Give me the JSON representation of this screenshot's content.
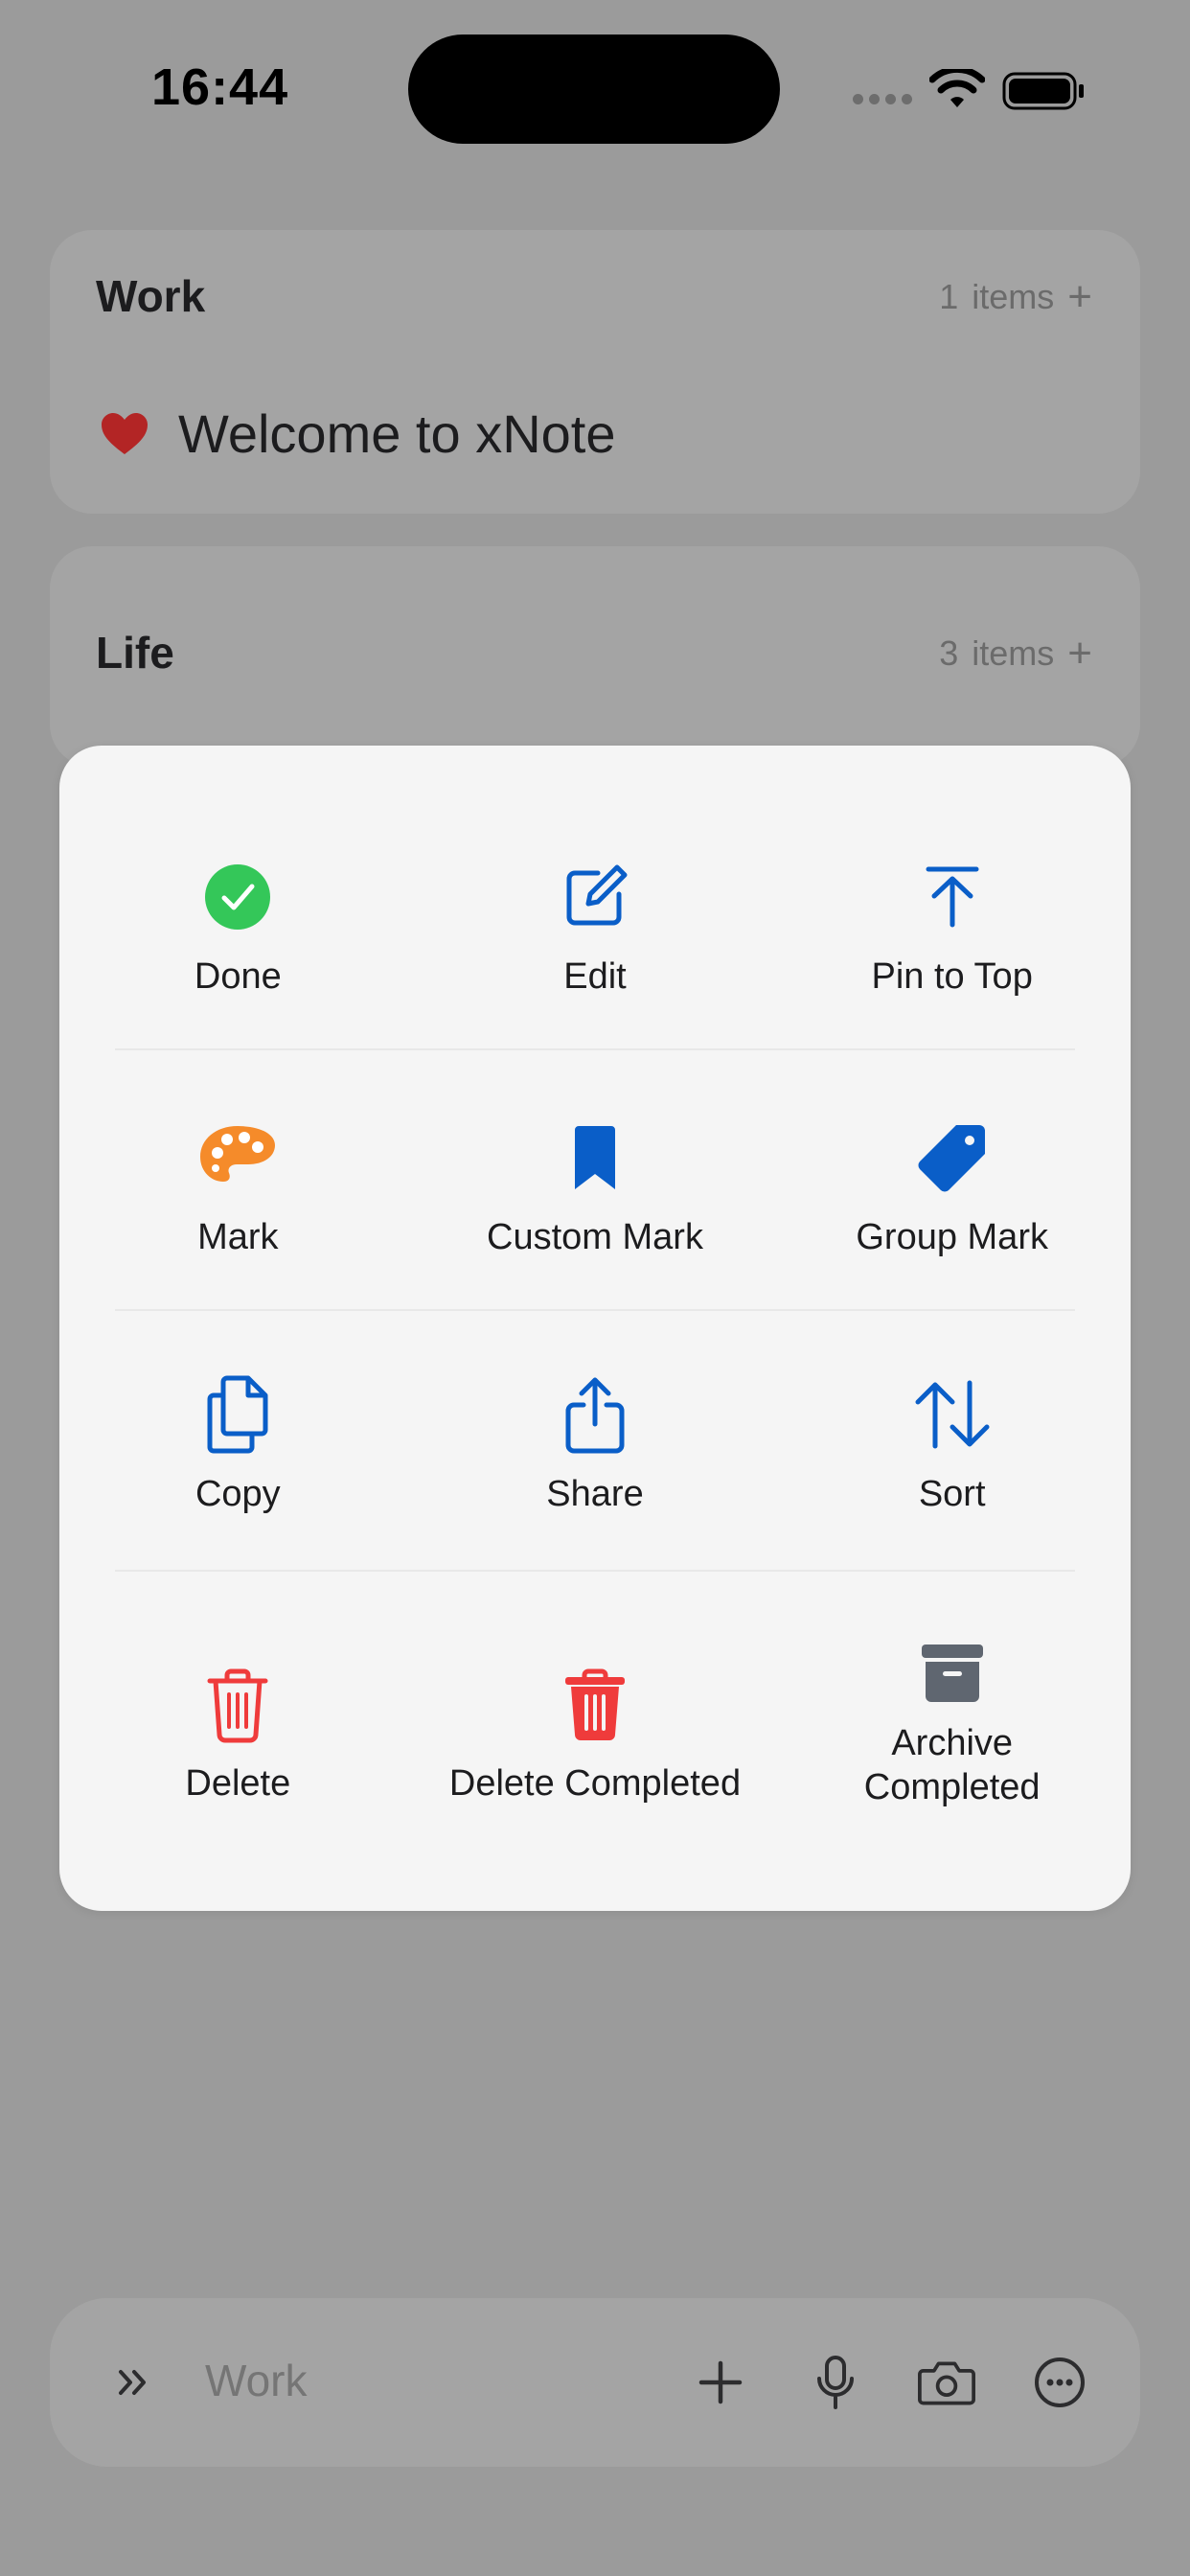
{
  "status_bar": {
    "time": "16:44"
  },
  "groups": [
    {
      "title": "Work",
      "count": "1",
      "items_word": "items",
      "note": "Welcome to xNote"
    },
    {
      "title": "Life",
      "count": "3",
      "items_word": "items"
    }
  ],
  "actions": [
    [
      {
        "label": "Done",
        "icon": "checkmark-circle-icon"
      },
      {
        "label": "Edit",
        "icon": "edit-icon"
      },
      {
        "label": "Pin to Top",
        "icon": "pin-to-top-icon"
      }
    ],
    [
      {
        "label": "Mark",
        "icon": "palette-icon"
      },
      {
        "label": "Custom Mark",
        "icon": "bookmark-icon"
      },
      {
        "label": "Group Mark",
        "icon": "tag-icon"
      }
    ],
    [
      {
        "label": "Copy",
        "icon": "copy-icon"
      },
      {
        "label": "Share",
        "icon": "share-icon"
      },
      {
        "label": "Sort",
        "icon": "sort-icon"
      }
    ],
    [
      {
        "label": "Delete",
        "icon": "trash-icon"
      },
      {
        "label": "Delete Completed",
        "icon": "trash-filled-icon"
      },
      {
        "label": "Archive\nCompleted",
        "icon": "archive-icon"
      }
    ]
  ],
  "colors": {
    "accent_blue": "#0a5ec8",
    "done_green": "#34c759",
    "mark_orange": "#f58b2a",
    "delete_red": "#ef3b3b",
    "archive_gray": "#5f6670"
  },
  "input_bar": {
    "placeholder": "Work"
  }
}
